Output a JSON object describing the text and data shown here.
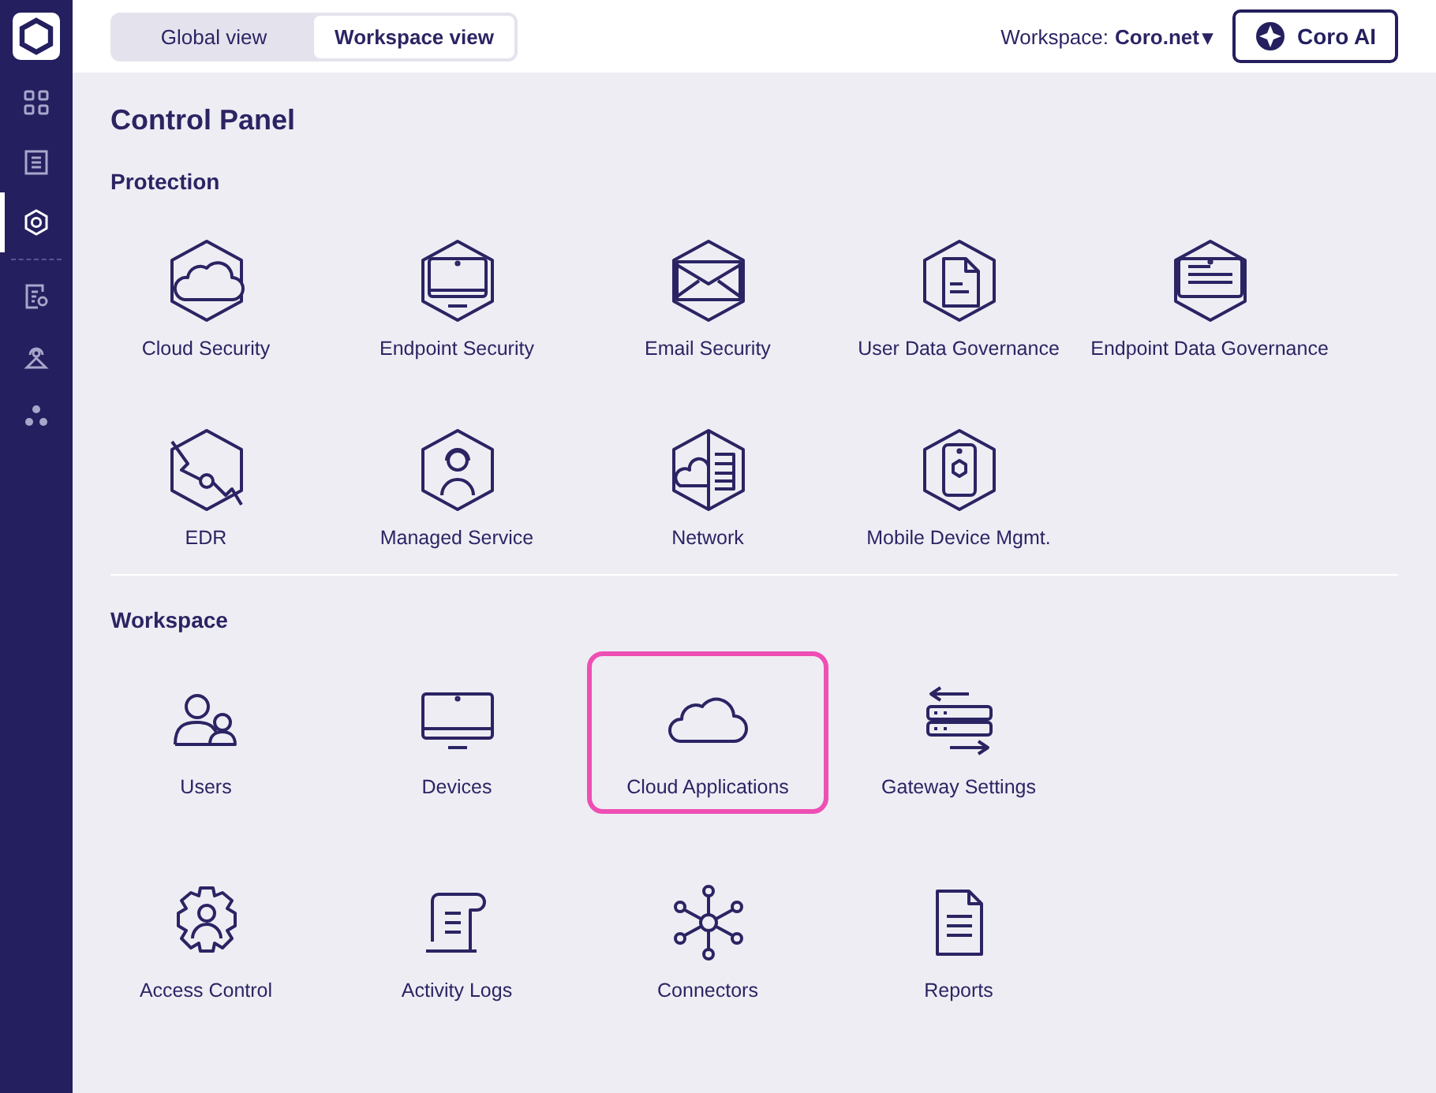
{
  "sidebar": {
    "items": [
      {
        "selected": false
      },
      {
        "selected": false
      },
      {
        "selected": true
      },
      {
        "selected": false
      },
      {
        "selected": false
      },
      {
        "selected": false
      }
    ]
  },
  "view_tabs": [
    {
      "label": "Global view",
      "selected": false
    },
    {
      "label": "Workspace view",
      "selected": true
    }
  ],
  "workspace_picker": {
    "label": "Workspace:",
    "value": "Coro.net",
    "caret": "▾"
  },
  "ai_button": {
    "label": "Coro AI"
  },
  "page_title": "Control Panel",
  "sections": [
    {
      "title": "Protection",
      "items": [
        {
          "label": "Cloud Security",
          "selected": false
        },
        {
          "label": "Endpoint Security",
          "selected": false
        },
        {
          "label": "Email Security",
          "selected": false
        },
        {
          "label": "User Data Governance",
          "selected": false
        },
        {
          "label": "Endpoint Data Governance",
          "selected": false
        },
        {
          "label": "EDR",
          "selected": false
        },
        {
          "label": "Managed Service",
          "selected": false
        },
        {
          "label": "Network",
          "selected": false
        },
        {
          "label": "Mobile Device Mgmt.",
          "selected": false
        }
      ]
    },
    {
      "title": "Workspace",
      "items": [
        {
          "label": "Users",
          "selected": false
        },
        {
          "label": "Devices",
          "selected": false
        },
        {
          "label": "Cloud Applications",
          "selected": true
        },
        {
          "label": "Gateway Settings",
          "selected": false
        },
        {
          "label": "Access Control",
          "selected": false
        },
        {
          "label": "Activity Logs",
          "selected": false
        },
        {
          "label": "Connectors",
          "selected": false
        },
        {
          "label": "Reports",
          "selected": false
        }
      ]
    }
  ]
}
